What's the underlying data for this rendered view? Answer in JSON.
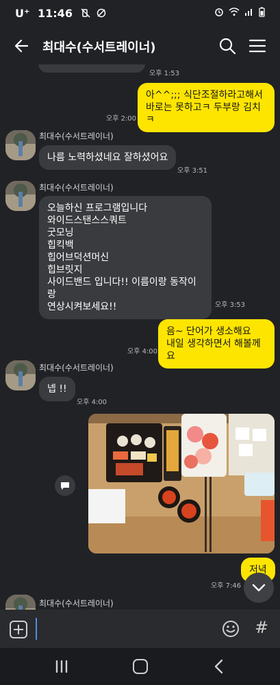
{
  "status_bar": {
    "carrier": "U⁺",
    "time": "11:46"
  },
  "header": {
    "title": "최대수(수서트레이너)"
  },
  "messages": [
    {
      "time": "오후 1:53"
    },
    {
      "text": "아^^;;; 식단조절하라고해서\n바로는 못하고ㅋ 두부랑 김치ㅋ",
      "time": "오후 2:00"
    },
    {
      "sender": "최대수(수서트레이너)",
      "text": "나름 노력하셨네요 잘하셨어요",
      "time": "오후 3:51"
    },
    {
      "sender": "최대수(수서트레이너)",
      "text": "오늘하신 프로그램입니다\n와이드스탠스스쿼트\n굿모닝\n힙킥백\n힙어브덕션머신\n힙브릿지\n사이드밴드 입니다!! 이름이랑 동작이랑\n연상시켜보세요!!",
      "time": "오후 3:53"
    },
    {
      "text": "음~ 단어가 생소해요\n내일 생각하면서 해볼께요",
      "time": "오후 4:00"
    },
    {
      "sender": "최대수(수서트레이너)",
      "text": "넵 !!",
      "time": "오후 4:00"
    },
    {
      "text": "저녁",
      "time": "오후 7:46"
    },
    {
      "sender": "최대수(수서트레이너)"
    }
  ],
  "input": {
    "placeholder": "",
    "hash": "#"
  }
}
